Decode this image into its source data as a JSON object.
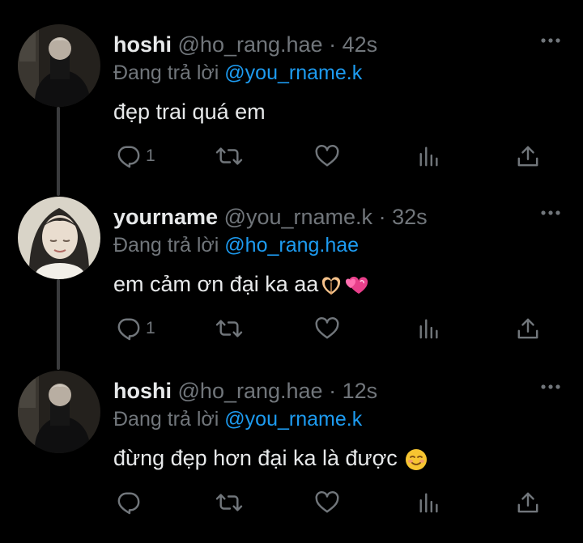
{
  "colors": {
    "background": "#000000",
    "text": "#e7e9ea",
    "muted": "#71767b",
    "link": "#1d9bf0",
    "thread_line": "#3a3b3d"
  },
  "reply_prefix": "Đang trả lời",
  "tweets": [
    {
      "display_name": "hoshi",
      "handle": "@ho_rang.hae",
      "time": "· 42s",
      "reply_to": "@you_rname.k",
      "text": "đẹp trai quá em",
      "emojis": [],
      "reply_count": "1",
      "avatar": "avatar-hoshi-photo"
    },
    {
      "display_name": "yourname",
      "handle": "@you_rname.k",
      "time": "· 32s",
      "reply_to": "@ho_rang.hae",
      "text": "em cảm ơn đại ka aa",
      "emojis": [
        "heart-hands-emoji",
        "two-hearts-emoji"
      ],
      "reply_count": "1",
      "avatar": "avatar-yourname-photo"
    },
    {
      "display_name": "hoshi",
      "handle": "@ho_rang.hae",
      "time": "· 12s",
      "reply_to": "@you_rname.k",
      "text": "đừng đẹp hơn đại ka là được",
      "emojis": [
        "smiling-face-emoji"
      ],
      "reply_count": "",
      "avatar": "avatar-hoshi-photo"
    }
  ],
  "icons": {
    "more": "more-dots-icon",
    "reply": "reply-bubble-icon",
    "retweet": "retweet-icon",
    "like": "heart-icon",
    "views": "views-chart-icon",
    "share": "share-upload-icon"
  }
}
